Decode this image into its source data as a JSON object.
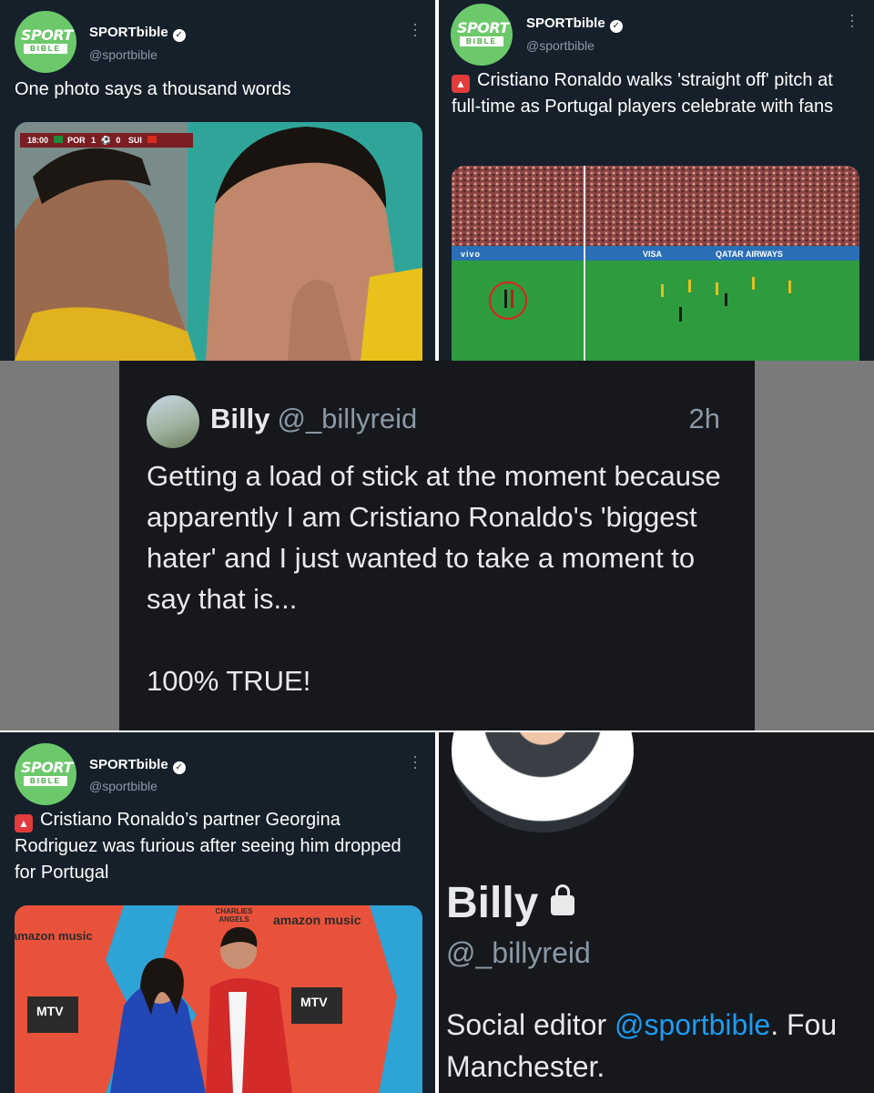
{
  "tweets": [
    {
      "account_name": "SPORTbible",
      "handle": "@sportbible",
      "logo_top": "SPORT",
      "logo_bottom": "BIBLE",
      "text": "One photo says a thousand words",
      "scoreboard": {
        "time": "18:00",
        "home": "POR",
        "home_score": "1",
        "away_score": "0",
        "away": "SUI"
      }
    },
    {
      "account_name": "SPORTbible",
      "handle": "@sportbible",
      "logo_top": "SPORT",
      "logo_bottom": "BIBLE",
      "text": "Cristiano Ronaldo walks 'straight off' pitch at full-time as Portugal players celebrate with fans",
      "ads": [
        "vivo",
        "VISA",
        "QATAR AIRWAYS"
      ]
    },
    {
      "account_name": "SPORTbible",
      "handle": "@sportbible",
      "logo_top": "SPORT",
      "logo_bottom": "BIBLE",
      "text": "Cristiano Ronaldo’s partner Georgina Rodriguez was furious after seeing him dropped for Portugal",
      "backdrop": [
        "amazon music",
        "CHARLIES ANGELS",
        "MTV"
      ]
    }
  ],
  "billy_tweet": {
    "name": "Billy",
    "handle": "@_billyreid",
    "time": "2h",
    "text_line1": "Getting a load of stick at the moment because apparently I am Cristiano Ronaldo's 'biggest hater' and I just wanted to take a moment to say that is...",
    "text_line2": "100% TRUE!"
  },
  "profile": {
    "name": "Billy",
    "handle": "@_billyreid",
    "bio_prefix": "Social editor ",
    "bio_mention": "@sportbible",
    "bio_suffix": ". Fou",
    "bio_line2": "Manchester."
  },
  "colors": {
    "panel_bg": "#15202b",
    "accent_blue": "#1d9bf0",
    "logo_green": "#6cc96b"
  }
}
